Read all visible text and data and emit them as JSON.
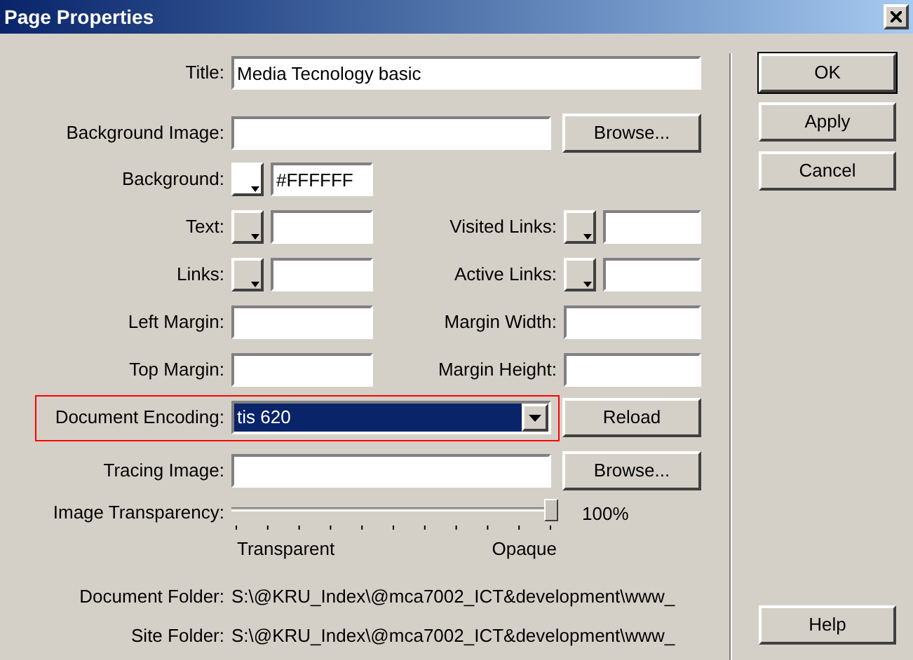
{
  "window": {
    "title": "Page Properties"
  },
  "title_field": {
    "label": "Title:",
    "value": "Media Tecnology basic"
  },
  "background_image": {
    "label": "Background Image:",
    "button": "Browse..."
  },
  "background": {
    "label": "Background:",
    "value": "#FFFFFF"
  },
  "pair_rows": [
    {
      "left": {
        "label": "Text:",
        "kind": "color"
      },
      "right": {
        "label": "Visited Links:",
        "kind": "color"
      }
    },
    {
      "left": {
        "label": "Links:",
        "kind": "color"
      },
      "right": {
        "label": "Active Links:",
        "kind": "color"
      }
    },
    {
      "left": {
        "label": "Left Margin:",
        "kind": "text"
      },
      "right": {
        "label": "Margin Width:",
        "kind": "text"
      }
    },
    {
      "left": {
        "label": "Top Margin:",
        "kind": "text"
      },
      "right": {
        "label": "Margin Height:",
        "kind": "text"
      }
    }
  ],
  "encoding": {
    "label": "Document Encoding:",
    "value": "tis 620",
    "button": "Reload",
    "highlighted": true
  },
  "tracing_image": {
    "label": "Tracing Image:",
    "button": "Browse..."
  },
  "transparency": {
    "label": "Image Transparency:",
    "level": 1.0,
    "reading": "100%",
    "min_label": "Transparent",
    "max_label": "Opaque"
  },
  "folders": [
    {
      "label": "Document Folder:",
      "value": "S:\\@KRU_Index\\@mca7002_ICT&development\\www_"
    },
    {
      "label": "Site Folder:",
      "value": "S:\\@KRU_Index\\@mca7002_ICT&development\\www_"
    }
  ],
  "buttons": [
    {
      "label": "OK",
      "default": true
    },
    {
      "label": "Apply",
      "default": false
    },
    {
      "label": "Cancel",
      "default": false
    }
  ],
  "help_button": "Help"
}
